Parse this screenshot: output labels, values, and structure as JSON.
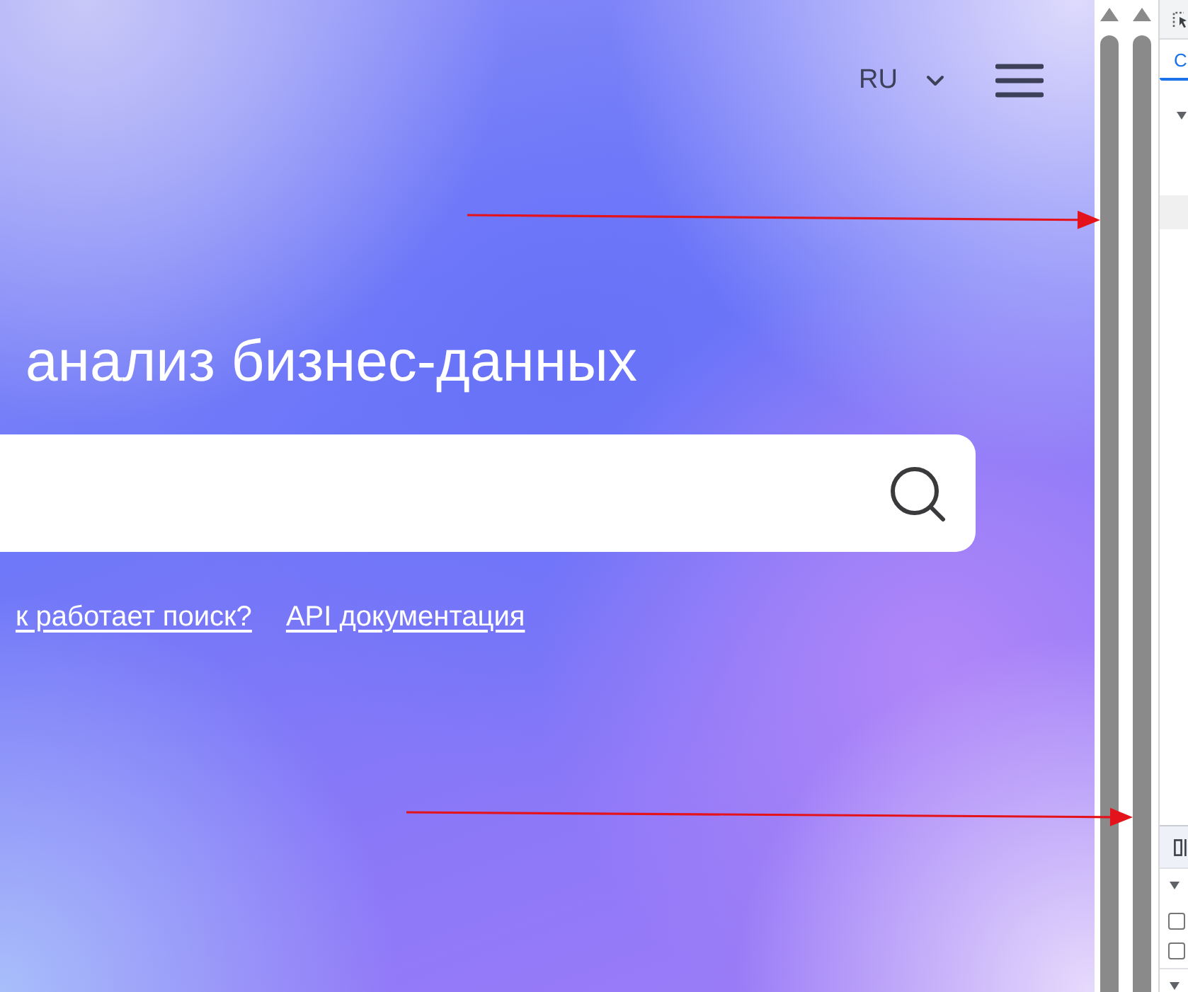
{
  "header": {
    "language": "RU"
  },
  "hero": {
    "heading": "анализ бизнес-данных",
    "links": [
      "к работает поиск?",
      "API документация"
    ]
  },
  "devtools": {
    "tabs": [
      {
        "label": "C",
        "selected": true
      }
    ],
    "tree_nodes": [
      {
        "expanded": true
      }
    ],
    "style_sections": [
      {
        "expanded": true,
        "checkboxes": [
          {
            "checked": false
          },
          {
            "checked": false
          }
        ]
      },
      {
        "expanded": true
      }
    ]
  }
}
